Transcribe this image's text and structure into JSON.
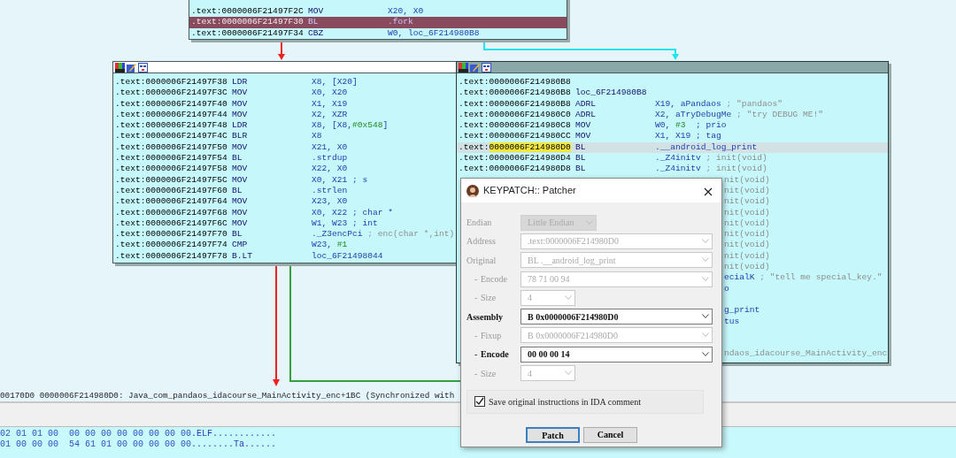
{
  "graph": {
    "blocks": [
      {
        "kind": "top",
        "lines": [
          {
            "kind": "code",
            "section": ".text:",
            "address": "0000006F21497F2C",
            "marked": false,
            "mnemonic": "MOV",
            "operands": [
              {
                "text": "X20, X0",
                "kind": "op"
              }
            ],
            "selected": false
          },
          {
            "kind": "code",
            "section": ".text:",
            "address": "0000006F21497F30",
            "marked": false,
            "mnemonic": "BL",
            "operands": [
              {
                "text": ".fork",
                "kind": "op"
              }
            ],
            "selected": true
          },
          {
            "kind": "code",
            "section": ".text:",
            "address": "0000006F21497F34",
            "marked": false,
            "mnemonic": "CBZ",
            "operands": [
              {
                "text": "W0, loc_6F214980B8",
                "kind": "op"
              }
            ],
            "selected": false
          }
        ]
      },
      {
        "kind": "left",
        "current": false,
        "lines": [
          {
            "kind": "code",
            "section": ".text:",
            "address": "0000006F21497F38",
            "marked": false,
            "mnemonic": "LDR",
            "operands": [
              {
                "text": "X8, [X20]",
                "kind": "op"
              }
            ],
            "selected": false
          },
          {
            "kind": "code",
            "section": ".text:",
            "address": "0000006F21497F3C",
            "marked": false,
            "mnemonic": "MOV",
            "operands": [
              {
                "text": "X0, X20",
                "kind": "op"
              }
            ],
            "selected": false
          },
          {
            "kind": "code",
            "section": ".text:",
            "address": "0000006F21497F40",
            "marked": false,
            "mnemonic": "MOV",
            "operands": [
              {
                "text": "X1, X19",
                "kind": "op"
              }
            ],
            "selected": false
          },
          {
            "kind": "code",
            "section": ".text:",
            "address": "0000006F21497F44",
            "marked": false,
            "mnemonic": "MOV",
            "operands": [
              {
                "text": "X2, XZR",
                "kind": "op"
              }
            ],
            "selected": false
          },
          {
            "kind": "code",
            "section": ".text:",
            "address": "0000006F21497F48",
            "marked": false,
            "mnemonic": "LDR",
            "operands": [
              {
                "text": "X8, [X8,",
                "kind": "op"
              },
              {
                "text": "#0x548",
                "kind": "imm"
              },
              {
                "text": "]",
                "kind": "op"
              }
            ],
            "selected": false
          },
          {
            "kind": "code",
            "section": ".text:",
            "address": "0000006F21497F4C",
            "marked": false,
            "mnemonic": "BLR",
            "operands": [
              {
                "text": "X8",
                "kind": "op"
              }
            ],
            "selected": false
          },
          {
            "kind": "code",
            "section": ".text:",
            "address": "0000006F21497F50",
            "marked": false,
            "mnemonic": "MOV",
            "operands": [
              {
                "text": "X21, X0",
                "kind": "op"
              }
            ],
            "selected": false
          },
          {
            "kind": "code",
            "section": ".text:",
            "address": "0000006F21497F54",
            "marked": false,
            "mnemonic": "BL",
            "operands": [
              {
                "text": ".strdup",
                "kind": "op"
              }
            ],
            "selected": false
          },
          {
            "kind": "code",
            "section": ".text:",
            "address": "0000006F21497F58",
            "marked": false,
            "mnemonic": "MOV",
            "operands": [
              {
                "text": "X22, X0",
                "kind": "op"
              }
            ],
            "selected": false
          },
          {
            "kind": "code",
            "section": ".text:",
            "address": "0000006F21497F5C",
            "marked": false,
            "mnemonic": "MOV",
            "operands": [
              {
                "text": "X0, X21 ; s",
                "kind": "op"
              }
            ],
            "selected": false
          },
          {
            "kind": "code",
            "section": ".text:",
            "address": "0000006F21497F60",
            "marked": false,
            "mnemonic": "BL",
            "operands": [
              {
                "text": ".strlen",
                "kind": "op"
              }
            ],
            "selected": false
          },
          {
            "kind": "code",
            "section": ".text:",
            "address": "0000006F21497F64",
            "marked": false,
            "mnemonic": "MOV",
            "operands": [
              {
                "text": "X23, X0",
                "kind": "op"
              }
            ],
            "selected": false
          },
          {
            "kind": "code",
            "section": ".text:",
            "address": "0000006F21497F68",
            "marked": false,
            "mnemonic": "MOV",
            "operands": [
              {
                "text": "X0, X22 ; char *",
                "kind": "op"
              }
            ],
            "selected": false
          },
          {
            "kind": "code",
            "section": ".text:",
            "address": "0000006F21497F6C",
            "marked": false,
            "mnemonic": "MOV",
            "operands": [
              {
                "text": "W1, W23 ; int",
                "kind": "op"
              }
            ],
            "selected": false
          },
          {
            "kind": "code",
            "section": ".text:",
            "address": "0000006F21497F70",
            "marked": false,
            "mnemonic": "BL",
            "operands": [
              {
                "text": "._Z3encPci",
                "kind": "op"
              },
              {
                "text": " ; enc(char *,int)",
                "kind": "cmt"
              }
            ],
            "selected": false
          },
          {
            "kind": "code",
            "section": ".text:",
            "address": "0000006F21497F74",
            "marked": false,
            "mnemonic": "CMP",
            "operands": [
              {
                "text": "W23, ",
                "kind": "op"
              },
              {
                "text": "#1",
                "kind": "imm"
              }
            ],
            "selected": false
          },
          {
            "kind": "code",
            "section": ".text:",
            "address": "0000006F21497F78",
            "marked": false,
            "mnemonic": "B.LT",
            "operands": [
              {
                "text": "loc_6F21498044",
                "kind": "op"
              }
            ],
            "selected": false
          }
        ]
      },
      {
        "kind": "right",
        "current": true,
        "lines": [
          {
            "kind": "code",
            "section": ".text:",
            "address": "0000006F214980B8",
            "marked": false,
            "selected": false
          },
          {
            "kind": "code",
            "section": ".text:",
            "address": "0000006F214980B8",
            "marked": false,
            "mnemonic": "loc_6F214980B8",
            "selected": false
          },
          {
            "kind": "code",
            "section": ".text:",
            "address": "0000006F214980B8",
            "marked": false,
            "mnemonic": "ADRL",
            "operands": [
              {
                "text": "X19, aPandaos",
                "kind": "op"
              },
              {
                "text": " ; \"pandaos\"",
                "kind": "cmt"
              }
            ],
            "selected": false
          },
          {
            "kind": "code",
            "section": ".text:",
            "address": "0000006F214980C0",
            "marked": false,
            "mnemonic": "ADRL",
            "operands": [
              {
                "text": "X2, aTryDebugMe",
                "kind": "op"
              },
              {
                "text": " ; \"try DEBUG ME!\"",
                "kind": "cmt"
              }
            ],
            "selected": false
          },
          {
            "kind": "code",
            "section": ".text:",
            "address": "0000006F214980C8",
            "marked": false,
            "mnemonic": "MOV",
            "operands": [
              {
                "text": "W0, ",
                "kind": "op"
              },
              {
                "text": "#3",
                "kind": "imm"
              },
              {
                "text": "  ; prio",
                "kind": "op"
              }
            ],
            "selected": false
          },
          {
            "kind": "code",
            "section": ".text:",
            "address": "0000006F214980CC",
            "marked": false,
            "mnemonic": "MOV",
            "operands": [
              {
                "text": "X1, X19 ; tag",
                "kind": "op"
              }
            ],
            "selected": false
          },
          {
            "kind": "code",
            "section": ".text:",
            "address": "0000006F214980D0",
            "marked": true,
            "mnemonic": "BL",
            "operands": [
              {
                "text": ".__android_log_print",
                "kind": "op"
              }
            ],
            "selected": true
          },
          {
            "kind": "code",
            "section": ".text:",
            "address": "0000006F214980D4",
            "marked": false,
            "mnemonic": "BL",
            "operands": [
              {
                "text": "._Z4initv",
                "kind": "op"
              },
              {
                "text": " ; init(void)",
                "kind": "cmt"
              }
            ],
            "selected": false
          },
          {
            "kind": "code",
            "section": ".text:",
            "address": "0000006F214980D8",
            "marked": false,
            "mnemonic": "BL",
            "operands": [
              {
                "text": "._Z4initv",
                "kind": "op"
              },
              {
                "text": " ; init(void)",
                "kind": "cmt"
              }
            ],
            "selected": false
          },
          {
            "kind": "tail",
            "operands": [
              {
                "text": "nit(void)",
                "kind": "cmt"
              }
            ],
            "selected": false
          },
          {
            "kind": "tail",
            "operands": [
              {
                "text": "nit(void)",
                "kind": "cmt"
              }
            ],
            "selected": false
          },
          {
            "kind": "tail",
            "operands": [
              {
                "text": "nit(void)",
                "kind": "cmt"
              }
            ],
            "selected": false
          },
          {
            "kind": "tail",
            "operands": [
              {
                "text": "nit(void)",
                "kind": "cmt"
              }
            ],
            "selected": false
          },
          {
            "kind": "tail",
            "operands": [
              {
                "text": "nit(void)",
                "kind": "cmt"
              }
            ],
            "selected": false
          },
          {
            "kind": "tail",
            "operands": [
              {
                "text": "nit(void)",
                "kind": "cmt"
              }
            ],
            "selected": false
          },
          {
            "kind": "tail",
            "operands": [
              {
                "text": "nit(void)",
                "kind": "cmt"
              }
            ],
            "selected": false
          },
          {
            "kind": "tail",
            "operands": [
              {
                "text": "nit(void)",
                "kind": "cmt"
              }
            ],
            "selected": false
          },
          {
            "kind": "tail",
            "operands": [
              {
                "text": "nit(void)",
                "kind": "cmt"
              }
            ],
            "selected": false
          },
          {
            "kind": "tail",
            "operands": [
              {
                "text": "ecialK",
                "kind": "op"
              },
              {
                "text": " ; \"tell me special_key.\"",
                "kind": "cmt"
              }
            ],
            "selected": false
          },
          {
            "kind": "tail",
            "operands": [
              {
                "text": "o",
                "kind": "op"
              }
            ],
            "selected": false
          },
          {
            "kind": "blank"
          },
          {
            "kind": "tail",
            "operands": [
              {
                "text": "g_print",
                "kind": "op"
              }
            ],
            "selected": false
          },
          {
            "kind": "tail",
            "operands": [
              {
                "text": "tus",
                "kind": "op"
              }
            ],
            "selected": false
          },
          {
            "kind": "blank"
          },
          {
            "kind": "blank"
          },
          {
            "kind": "tail",
            "operands": [
              {
                "text": "ndaos_idacourse_MainActivity_enc",
                "kind": "cmt"
              }
            ],
            "selected": false
          }
        ]
      }
    ],
    "edges": [
      {
        "color": "#ee2020"
      },
      {
        "color": "#20e4ee"
      },
      {
        "color": "#ee2020"
      },
      {
        "color": "#30a040"
      }
    ]
  },
  "status_line": "00170D0 0000006F214980D0: Java_com_pandaos_idacourse_MainActivity_enc+1BC (Synchronized with",
  "hex_rows": [
    {
      "bytes": "02 01 01 00  00 00 00 00 00 00 00 00",
      "ascii": ".ELF............"
    },
    {
      "bytes": "01 00 00 00  54 61 01 00 00 00 00 00",
      "ascii": "........Ta......"
    }
  ],
  "dialog": {
    "title": "KEYPATCH:: Patcher",
    "fields": [
      {
        "kind": "medium",
        "label": "Endian",
        "value": "Little Endian",
        "disabled": true
      },
      {
        "kind": "wide",
        "label": "Address",
        "value": ".text:0000006F214980D0",
        "disabled": true
      },
      {
        "kind": "wide",
        "label": "Original",
        "value": "BL .__android_log_print",
        "disabled": true
      },
      {
        "kind": "wide",
        "prefix": "-",
        "label": "Encode",
        "value": "78 71 00 94",
        "disabled": true
      },
      {
        "kind": "narrow",
        "prefix": "-",
        "label": "Size",
        "value": "4",
        "disabled": true
      },
      {
        "kind": "wide",
        "label": "Assembly",
        "value": "B 0x0000006F214980D0",
        "disabled": false
      },
      {
        "kind": "wide",
        "prefix": "-",
        "label": "Fixup",
        "value": "B 0x0000006F214980D0",
        "disabled": true
      },
      {
        "kind": "wide",
        "prefix": "-",
        "label": "Encode",
        "value": "00 00 00 14",
        "disabled": false
      },
      {
        "kind": "narrow",
        "prefix": "-",
        "label": "Size",
        "value": "4",
        "disabled": true
      }
    ],
    "checkbox": {
      "label": "Save original instructions in IDA comment",
      "checked": true
    },
    "buttons": [
      {
        "label": "Patch",
        "default": true
      },
      {
        "label": "Cancel",
        "default": false
      }
    ]
  }
}
